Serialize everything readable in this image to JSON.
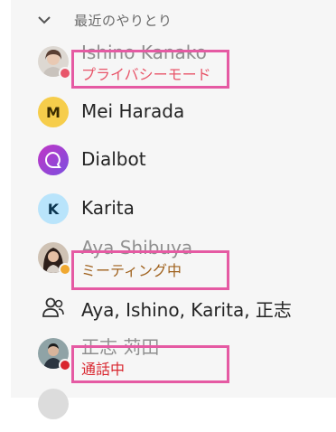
{
  "section": {
    "title": "最近のやりとり",
    "chevron_icon": "chevron-down-icon"
  },
  "contacts": [
    {
      "name": "Ishino Kanako",
      "status_text": "プライバシーモード",
      "status_color": "#e8566a",
      "dot_color": "#e8566a"
    },
    {
      "name": "Mei Harada",
      "initial": "M",
      "avatar_color": "#f6cd4b"
    },
    {
      "name": "Dialbot",
      "icon": "chat-bubble-icon"
    },
    {
      "name": "Karita",
      "initial": "K",
      "avatar_color": "#b9e4fb"
    },
    {
      "name": "Aya Shibuya",
      "status_text": "ミーティング中",
      "status_color": "#a0621e",
      "dot_color": "#f0a830"
    },
    {
      "name": "Aya, Ishino, Karita, 正志",
      "icon": "group-icon"
    },
    {
      "name": "正志 苅田",
      "status_text": "通話中",
      "status_color": "#d9262e",
      "dot_color": "#d9262e"
    }
  ],
  "colors": {
    "highlight": "#e55aa3",
    "background": "#f6f6f6"
  }
}
